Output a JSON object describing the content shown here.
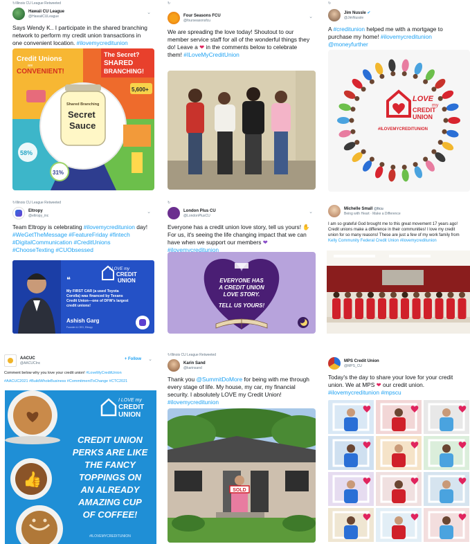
{
  "tweets": [
    {
      "retweet": "Illinois CU League Retweeted",
      "name": "Hawaii CU League",
      "handle": "@HawaiiCULeague",
      "text": "Says Wendy K.. I participate in the shared branching network to perform my credit union transactions in one convenient location.",
      "tags": "#ilovemycreditunion",
      "graphic": {
        "heading_a": "Credit Unions",
        "heading_b": "are",
        "heading_c": "CONVENIENT!",
        "secret": "The Secret?",
        "shared": "SHARED",
        "branching": "BRANCHING!",
        "jar_label_top": "Shared Branching",
        "jar_label_mid": "Secret",
        "jar_label_bot": "Sauce",
        "stat_a": "5,600+",
        "stat_b": "58%",
        "stat_c": "31%"
      }
    },
    {
      "retweet": "",
      "name": "Four Seasons FCU",
      "handle": "@fourseasonsfcu",
      "text_a": "We are spreading the love today! Shoutout to our member service staff for all of the wonderful things they do! Leave a",
      "text_b": "in the comments below to celebrate them!",
      "tags": "#ILoveMyCreditUnion"
    },
    {
      "retweet": "",
      "name": "Jim Nussle",
      "handle": "@JimNussle",
      "text_a": "A",
      "tag_a": "#creditunion",
      "text_b": "helped me with a mortgage to purchase my home!",
      "tags": "#ilovemycreditunion @moneyfurther",
      "logo_a": "LOVE",
      "logo_b": "my",
      "logo_c": "CREDIT",
      "logo_d": "UNION",
      "logo_tag": "#ILOVEMYCREDITUNION"
    },
    {
      "retweet": "Illinois CU League Retweeted",
      "name": "Eltropy",
      "handle": "@eltropy_inc",
      "text_a": "Team Eltropy is celebrating",
      "tag_a": "#ilovemycreditunion",
      "text_b": "day!",
      "tags": "#WeGetTheMessage #FeatureFriday #fintech #DigitalCommunication #CreditUnions #ChooseTexting #CUObsessed",
      "card_quote": "My FIRST CAR (a used Toyota Corolla) was financed by Texans Credit Union—one of DFW's largest credit unions!",
      "card_person": "Ashish Garg",
      "card_role": "Founder & CEO, Eltropy",
      "logo_a": "I LOVE my",
      "logo_b": "CREDIT",
      "logo_c": "UNION"
    },
    {
      "retweet": "",
      "name": "London Plus CU",
      "handle": "@LondonPlusCU",
      "text_a": "Everyone has a credit union love story, tell us yours!",
      "text_b": "For us, it's seeing the life changing impact that we can have when we support our members",
      "tags": "#ilovemycreditunion",
      "heart_line1": "EVERYONE HAS",
      "heart_line2": "A CREDIT UNION",
      "heart_line3": "LOVE STORY.",
      "heart_line4": "TELL US YOURS!"
    },
    {
      "retweet": "",
      "name": "Michelle Small",
      "handle": "@ltcu",
      "status": "Being with Heart · Make a Difference",
      "text_a": "I am so grateful God brought me to this great movement 17 years ago! Credit unions make a difference in their communities! I love my credit union for so many reasons! These are just a few of my work family from",
      "tag_a": "Kelly Community Federal Credit Union",
      "tags": "#ilovemycreditunion"
    },
    {
      "retweet": "",
      "name": "AACUC",
      "handle": "@AACUCInc",
      "follow": "+ Follow",
      "text": "Comment below why you love your credit union!",
      "tag_a": "#LoveMyCreditUnion",
      "tags": "#AACUC2021 #BuildWholeBusiness #CommitmentToChange #CTC2021",
      "logo_a": "I LOVE my",
      "logo_b": "CREDIT",
      "logo_c": "UNION",
      "perks_1": "CREDIT UNION",
      "perks_2": "PERKS ARE LIKE",
      "perks_3": "THE FANCY",
      "perks_4": "TOPPINGS ON",
      "perks_5": "AN ALREADY",
      "perks_6": "AMAZING CUP",
      "perks_7": "OF COFFEE!",
      "footer_tag": "#ILOVEMYCREDITUNION"
    },
    {
      "retweet": "Illinois CU League Retweeted",
      "name": "Karin Sand",
      "handle": "@karinsand",
      "text_a": "Thank you",
      "tag_a": "@SummitDoMore",
      "text_b": "for being with me through every stage of life. My house, my car, my financial security. I absolutely LOVE my Credit Union!",
      "tags": "#ilovemycreditunion",
      "sign": "SOLD"
    },
    {
      "retweet": "",
      "name": "MPS Credit Union",
      "handle": "@MPS_CU",
      "text_a": "Today's the day to share your love for your credit union. We at MPS",
      "text_b": "our credit union.",
      "tags": "#ilovemycreditunion #mpscu"
    }
  ],
  "colors": {
    "twitter_blue": "#1da1f2",
    "love_red": "#e0245e",
    "eltropy_blue": "#2451c6",
    "london_purple": "#6b2f8f",
    "aacuc_blue": "#1f8fd6"
  }
}
